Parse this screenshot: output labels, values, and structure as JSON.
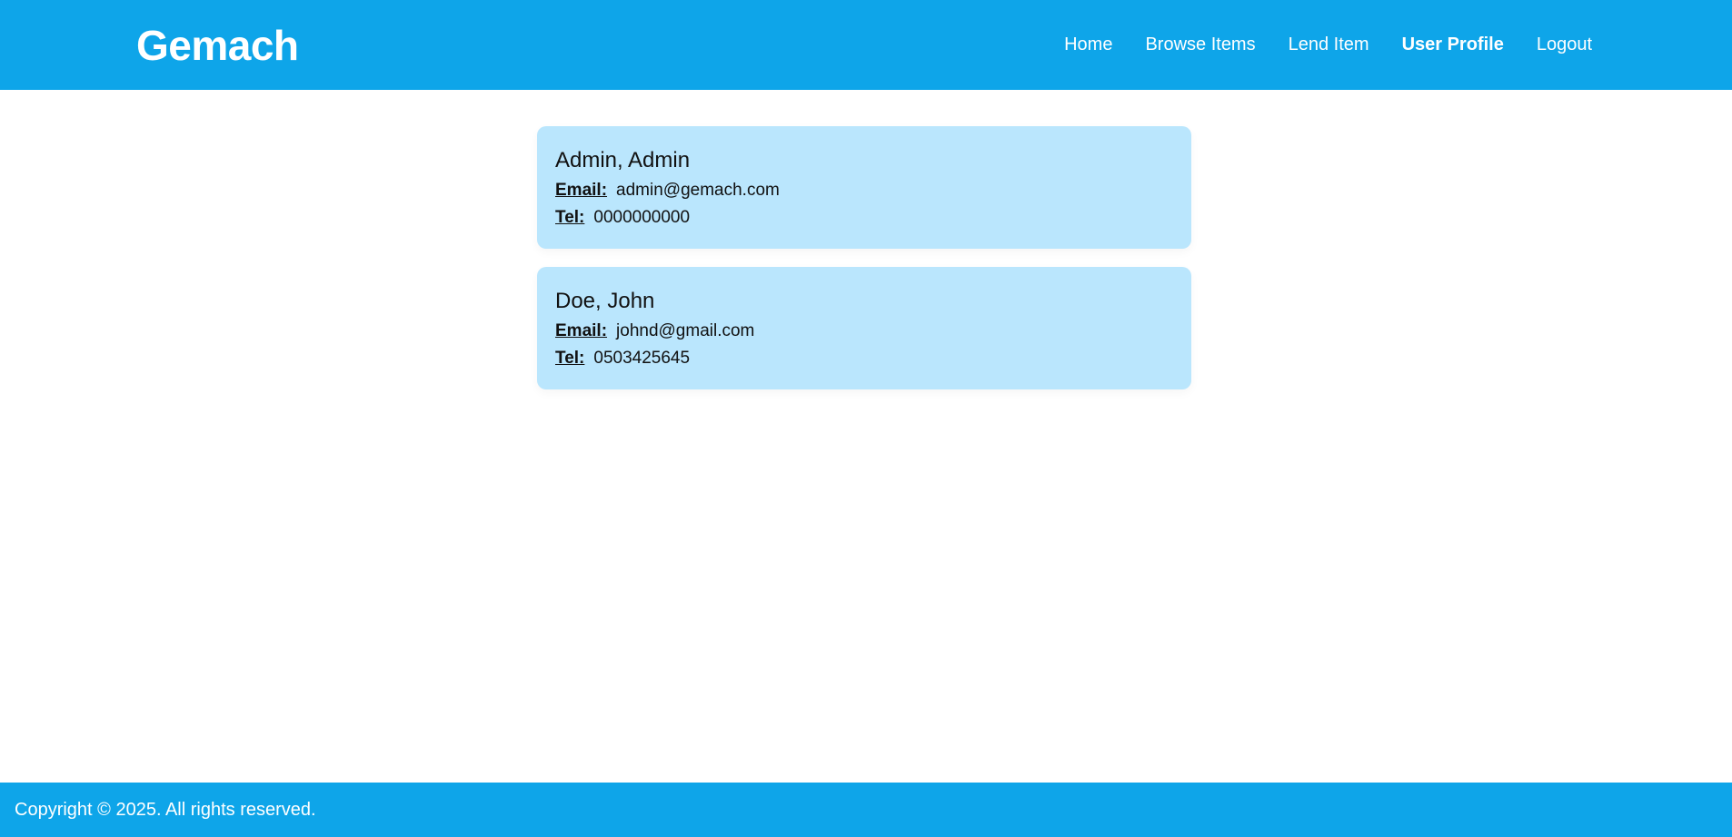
{
  "header": {
    "logo": "Gemach",
    "nav": [
      {
        "label": "Home"
      },
      {
        "label": "Browse Items"
      },
      {
        "label": "Lend Item"
      },
      {
        "label": "User Profile"
      },
      {
        "label": "Logout"
      }
    ]
  },
  "users": [
    {
      "name": "Admin, Admin",
      "email_label": "Email:",
      "email": "admin@gemach.com",
      "tel_label": "Tel:",
      "tel": "0000000000"
    },
    {
      "name": "Doe, John",
      "email_label": "Email:",
      "email": "johnd@gmail.com",
      "tel_label": "Tel:",
      "tel": "0503425645"
    }
  ],
  "footer": {
    "text": "Copyright © 2025. All rights reserved."
  },
  "colors": {
    "brand": "#0ea5e9",
    "card_background": "#bae6fd",
    "text": "#111111"
  }
}
